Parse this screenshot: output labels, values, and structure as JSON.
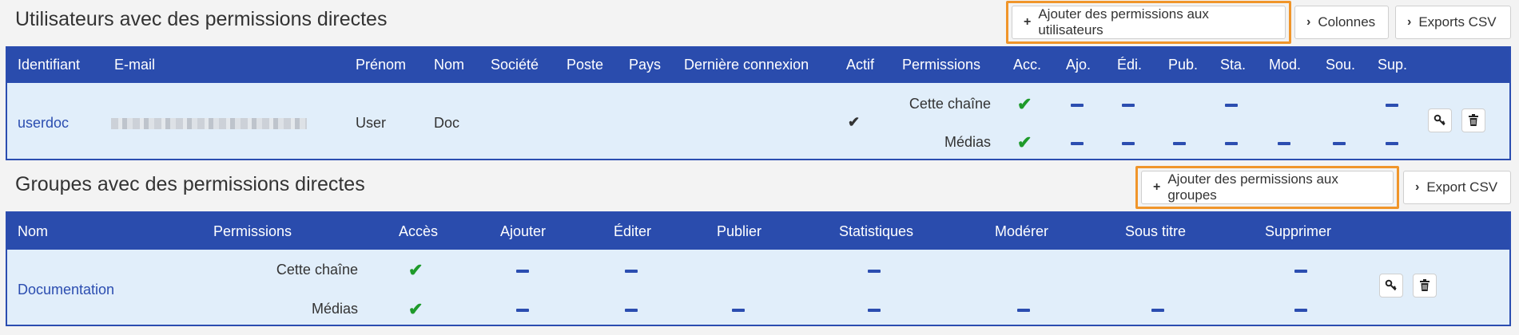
{
  "users_section": {
    "title": "Utilisateurs avec des permissions directes",
    "add_button": "Ajouter des permissions aux utilisateurs",
    "columns_button": "Colonnes",
    "export_button": "Exports CSV",
    "headers": [
      "Identifiant",
      "E-mail",
      "Prénom",
      "Nom",
      "Société",
      "Poste",
      "Pays",
      "Dernière connexion",
      "Actif",
      "Permissions",
      "Acc.",
      "Ajo.",
      "Édi.",
      "Pub.",
      "Sta.",
      "Mod.",
      "Sou.",
      "Sup."
    ],
    "row": {
      "identifiant": "userdoc",
      "prenom": "User",
      "nom": "Doc",
      "perm_labels": [
        "Cette chaîne",
        "Médias"
      ]
    }
  },
  "groups_section": {
    "title": "Groupes avec des permissions directes",
    "add_button": "Ajouter des permissions aux groupes",
    "export_button": "Export CSV",
    "headers": [
      "Nom",
      "Permissions",
      "Accès",
      "Ajouter",
      "Éditer",
      "Publier",
      "Statistiques",
      "Modérer",
      "Sous titre",
      "Supprimer"
    ],
    "row": {
      "nom": "Documentation",
      "perm_labels": [
        "Cette chaîne",
        "Médias"
      ]
    }
  },
  "colors": {
    "header": "#2a4cad",
    "row": "#e1eefa",
    "accent_outline": "#f0952a",
    "check": "#1e9a2a"
  },
  "icons": [
    "plus-icon",
    "chevron-right-icon",
    "check-icon",
    "minus-icon",
    "key-icon",
    "trash-icon"
  ]
}
